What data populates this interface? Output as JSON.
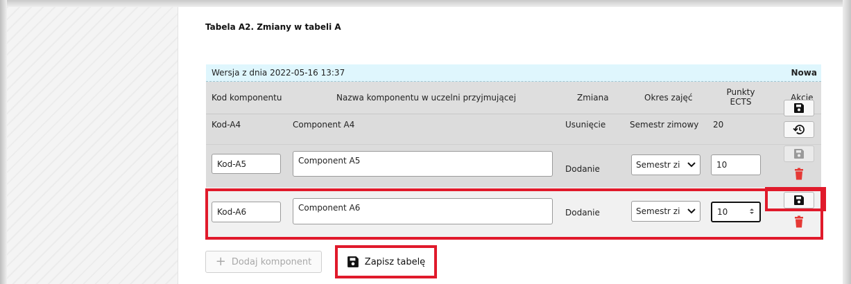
{
  "table": {
    "title": "Tabela A2. Zmiany w tabeli A",
    "version_text": "Wersja z dnia 2022-05-16 13:37",
    "status": "Nowa",
    "headers": {
      "code": "Kod komponentu",
      "name": "Nazwa komponentu w uczelni przyjmującej",
      "change": "Zmiana",
      "period": "Okres zajęć",
      "ects_line1": "Punkty",
      "ects_line2": "ECTS",
      "actions": "Akcje"
    },
    "rows": [
      {
        "code": "Kod-A4",
        "name": "Component A4",
        "change": "Usunięcie",
        "period": "Semestr zimowy",
        "ects": "20"
      },
      {
        "code": "Kod-A5",
        "name": "Component A5",
        "change": "Dodanie",
        "period": "Semestr zi",
        "ects": "10"
      },
      {
        "code": "Kod-A6",
        "name": "Component A6",
        "change": "Dodanie",
        "period": "Semestr zi",
        "ects": "10"
      }
    ]
  },
  "buttons": {
    "add_component": "Dodaj komponent",
    "save_table": "Zapisz tabelę"
  },
  "icons": {
    "save": "floppy-disk-icon",
    "restore": "history-icon",
    "delete": "trash-icon",
    "add": "plus-icon",
    "dropdown": "chevron-down-icon",
    "spinner": "spinner-arrows-icon"
  },
  "colors": {
    "highlight": "#e01a2b",
    "version_bar": "#dff6fd",
    "delete_icon": "#e53935",
    "disabled_icon": "#9a9a9a"
  }
}
